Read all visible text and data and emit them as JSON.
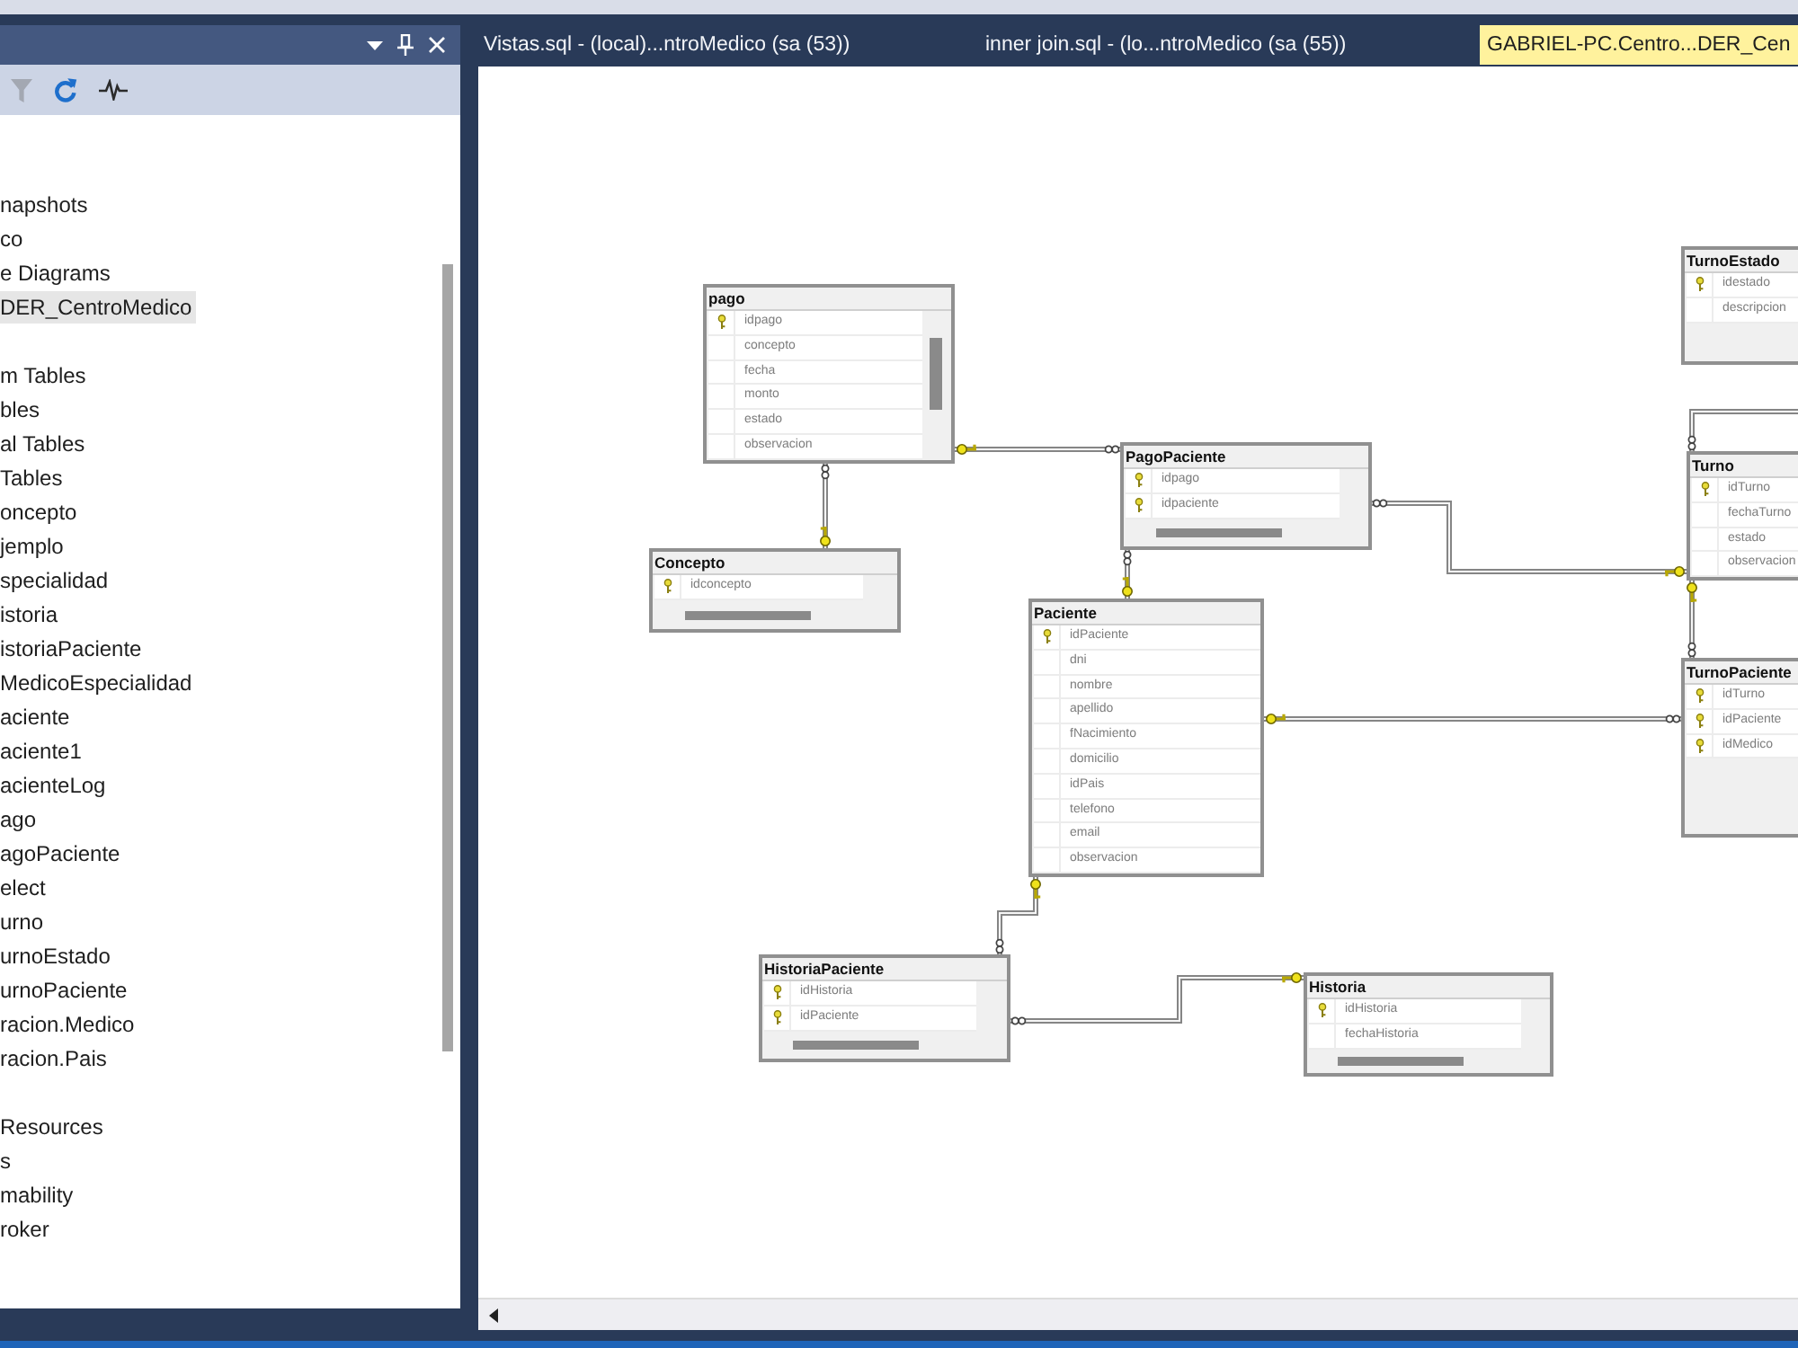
{
  "object_explorer": {
    "toolbar": [
      {
        "kind": "filter",
        "disabled": true
      },
      {
        "kind": "refresh",
        "disabled": false
      },
      {
        "kind": "activity",
        "disabled": false
      }
    ],
    "tree": [
      {
        "label": "napshots",
        "selected": false
      },
      {
        "label": "co",
        "selected": false
      },
      {
        "label": "e Diagrams",
        "selected": false
      },
      {
        "label": "DER_CentroMedico",
        "selected": true
      },
      {
        "label": "m Tables",
        "selected": false
      },
      {
        "label": "bles",
        "selected": false
      },
      {
        "label": "al Tables",
        "selected": false
      },
      {
        "label": "Tables",
        "selected": false
      },
      {
        "label": "oncepto",
        "selected": false
      },
      {
        "label": "jemplo",
        "selected": false
      },
      {
        "label": "specialidad",
        "selected": false
      },
      {
        "label": "istoria",
        "selected": false
      },
      {
        "label": "istoriaPaciente",
        "selected": false
      },
      {
        "label": "MedicoEspecialidad",
        "selected": false
      },
      {
        "label": "aciente",
        "selected": false
      },
      {
        "label": "aciente1",
        "selected": false
      },
      {
        "label": "acienteLog",
        "selected": false
      },
      {
        "label": "ago",
        "selected": false
      },
      {
        "label": "agoPaciente",
        "selected": false
      },
      {
        "label": "elect",
        "selected": false
      },
      {
        "label": "urno",
        "selected": false
      },
      {
        "label": "urnoEstado",
        "selected": false
      },
      {
        "label": "urnoPaciente",
        "selected": false
      },
      {
        "label": "racion.Medico",
        "selected": false
      },
      {
        "label": "racion.Pais",
        "selected": false
      },
      {
        "label": "Resources",
        "selected": false
      },
      {
        "label": "s",
        "selected": false
      },
      {
        "label": "mability",
        "selected": false
      },
      {
        "label": "roker",
        "selected": false
      }
    ]
  },
  "tabs": [
    {
      "label": "Vistas.sql - (local)...ntroMedico (sa (53))",
      "selected": false
    },
    {
      "label": "inner join.sql - (lo...ntroMedico (sa (55))",
      "selected": false
    },
    {
      "label": "GABRIEL-PC.Centro...DER_Cen",
      "selected": true
    }
  ],
  "diagram": {
    "tables": [
      {
        "name": "pago",
        "columns": [
          {
            "name": "idpago",
            "primary_key": true
          },
          {
            "name": "concepto",
            "primary_key": false
          },
          {
            "name": "fecha",
            "primary_key": false
          },
          {
            "name": "monto",
            "primary_key": false
          },
          {
            "name": "estado",
            "primary_key": false
          },
          {
            "name": "observacion",
            "primary_key": false
          }
        ]
      },
      {
        "name": "Concepto",
        "columns": [
          {
            "name": "idconcepto",
            "primary_key": true
          }
        ]
      },
      {
        "name": "PagoPaciente",
        "columns": [
          {
            "name": "idpago",
            "primary_key": true
          },
          {
            "name": "idpaciente",
            "primary_key": true
          }
        ]
      },
      {
        "name": "Paciente",
        "columns": [
          {
            "name": "idPaciente",
            "primary_key": true
          },
          {
            "name": "dni",
            "primary_key": false
          },
          {
            "name": "nombre",
            "primary_key": false
          },
          {
            "name": "apellido",
            "primary_key": false
          },
          {
            "name": "fNacimiento",
            "primary_key": false
          },
          {
            "name": "domicilio",
            "primary_key": false
          },
          {
            "name": "idPais",
            "primary_key": false
          },
          {
            "name": "telefono",
            "primary_key": false
          },
          {
            "name": "email",
            "primary_key": false
          },
          {
            "name": "observacion",
            "primary_key": false
          }
        ]
      },
      {
        "name": "TurnoEstado",
        "columns": [
          {
            "name": "idestado",
            "primary_key": true
          },
          {
            "name": "descripcion",
            "primary_key": false
          }
        ]
      },
      {
        "name": "Turno",
        "columns": [
          {
            "name": "idTurno",
            "primary_key": true
          },
          {
            "name": "fechaTurno",
            "primary_key": false
          },
          {
            "name": "estado",
            "primary_key": false
          },
          {
            "name": "observacion",
            "primary_key": false
          }
        ]
      },
      {
        "name": "TurnoPaciente",
        "columns": [
          {
            "name": "idTurno",
            "primary_key": true
          },
          {
            "name": "idPaciente",
            "primary_key": true
          },
          {
            "name": "idMedico",
            "primary_key": true
          }
        ]
      },
      {
        "name": "HistoriaPaciente",
        "columns": [
          {
            "name": "idHistoria",
            "primary_key": true
          },
          {
            "name": "idPaciente",
            "primary_key": true
          }
        ]
      },
      {
        "name": "Historia",
        "columns": [
          {
            "name": "idHistoria",
            "primary_key": true
          },
          {
            "name": "fechaHistoria",
            "primary_key": false
          }
        ]
      }
    ]
  }
}
